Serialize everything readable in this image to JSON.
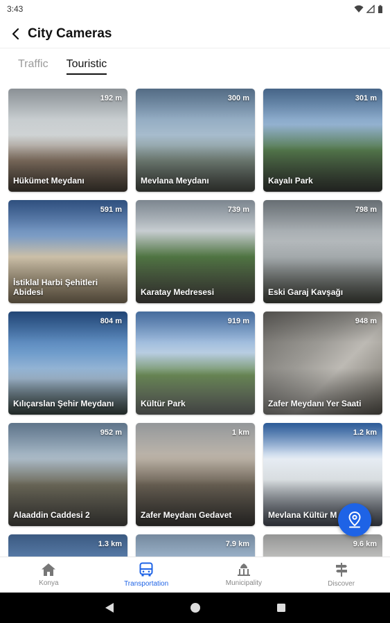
{
  "status": {
    "time": "3:43"
  },
  "header": {
    "title": "City Cameras"
  },
  "tabs": [
    {
      "label": "Traffic",
      "active": false
    },
    {
      "label": "Touristic",
      "active": true
    }
  ],
  "cameras": [
    {
      "name": "Hükümet Meydanı",
      "distance": "192 m"
    },
    {
      "name": "Mevlana Meydanı",
      "distance": "300 m"
    },
    {
      "name": "Kayalı Park",
      "distance": "301 m"
    },
    {
      "name": "İstiklal Harbi Şehitleri Abidesi",
      "distance": "591 m"
    },
    {
      "name": "Karatay Medresesi",
      "distance": "739 m"
    },
    {
      "name": "Eski Garaj Kavşağı",
      "distance": "798 m"
    },
    {
      "name": "Kılıçarslan Şehir Meydanı",
      "distance": "804 m"
    },
    {
      "name": "Kültür Park",
      "distance": "919 m"
    },
    {
      "name": "Zafer Meydanı Yer Saati",
      "distance": "948 m"
    },
    {
      "name": "Alaaddin Caddesi 2",
      "distance": "952 m"
    },
    {
      "name": "Zafer Meydanı Gedavet",
      "distance": "1 km"
    },
    {
      "name": "Mevlana Kültür M",
      "distance": "1.2 km"
    },
    {
      "name": "",
      "distance": "1.3 km"
    },
    {
      "name": "",
      "distance": "7.9 km"
    },
    {
      "name": "",
      "distance": "9.6 km"
    }
  ],
  "bottom_nav": [
    {
      "label": "Konya",
      "icon": "home-icon",
      "active": false
    },
    {
      "label": "Transportation",
      "icon": "bus-icon",
      "active": true
    },
    {
      "label": "Municipality",
      "icon": "municipality-icon",
      "active": false
    },
    {
      "label": "Discover",
      "icon": "signpost-icon",
      "active": false
    }
  ],
  "colors": {
    "accent": "#1e63e6",
    "inactive": "#888888"
  }
}
